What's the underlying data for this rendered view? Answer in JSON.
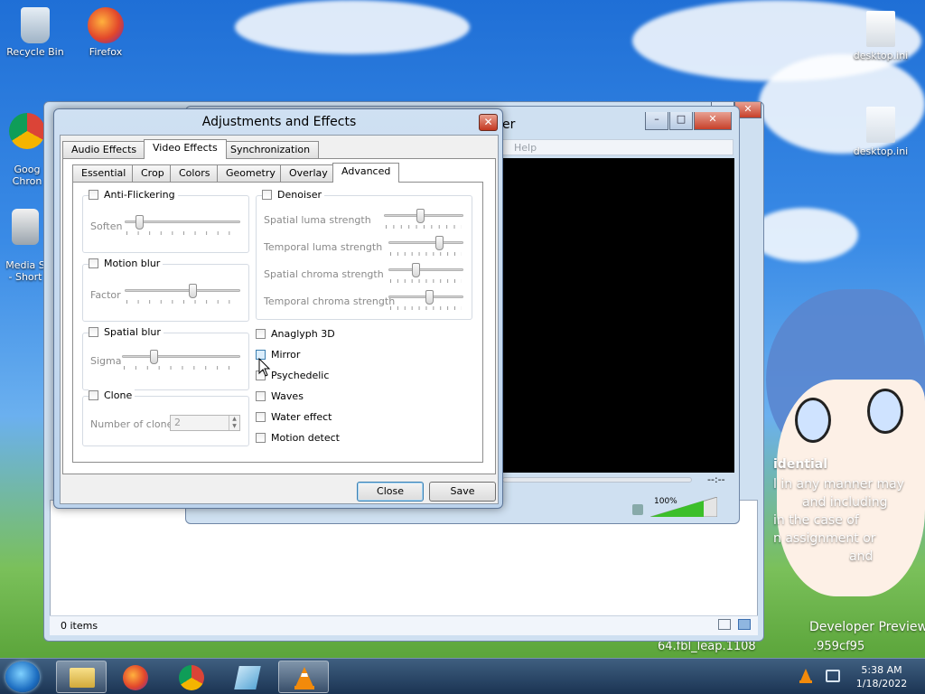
{
  "desktop": {
    "icons": [
      {
        "label": "Recycle Bin"
      },
      {
        "label": "Firefox"
      },
      {
        "label": "Goog\nChron"
      },
      {
        "label": "Media S\n- Short"
      },
      {
        "label": "desktop.ini"
      },
      {
        "label": "desktop.ini"
      }
    ],
    "watermark": {
      "line1": "idential",
      "line2": "l in any manner may",
      "line3": "and including",
      "line4": "in the case of",
      "line5": "n assignment or",
      "line6": "and",
      "dev": "Developer Preview",
      "build": "64.fbl_leap.1108",
      "build2": ".959cf95"
    }
  },
  "explorer": {
    "status": "0 items"
  },
  "vlc": {
    "title_fragment": "er",
    "menu_fragment": "Help",
    "time": "--:--",
    "volume": "100%"
  },
  "dialog": {
    "title": "Adjustments and Effects",
    "tabs": [
      "Audio Effects",
      "Video Effects",
      "Synchronization"
    ],
    "subtabs": [
      "Essential",
      "Crop",
      "Colors",
      "Geometry",
      "Overlay",
      "Advanced"
    ],
    "anti_flickering": {
      "label": "Anti-Flickering",
      "param": "Soften",
      "value": 0.1
    },
    "motion_blur": {
      "label": "Motion blur",
      "param": "Factor",
      "value": 0.6
    },
    "spatial_blur": {
      "label": "Spatial blur",
      "param": "Sigma",
      "value": 0.25
    },
    "clone": {
      "label": "Clone",
      "param": "Number of clones",
      "value": "2"
    },
    "denoiser": {
      "label": "Denoiser",
      "params": [
        {
          "label": "Spatial luma strength",
          "value": 0.45
        },
        {
          "label": "Temporal luma strength",
          "value": 0.7
        },
        {
          "label": "Spatial chroma strength",
          "value": 0.35
        },
        {
          "label": "Temporal chroma strength",
          "value": 0.55
        }
      ]
    },
    "checks": [
      "Anaglyph 3D",
      "Mirror",
      "Psychedelic",
      "Waves",
      "Water effect",
      "Motion detect"
    ],
    "buttons": {
      "close": "Close",
      "save": "Save"
    }
  },
  "taskbar": {
    "time": "5:38 AM",
    "date": "1/18/2022"
  }
}
